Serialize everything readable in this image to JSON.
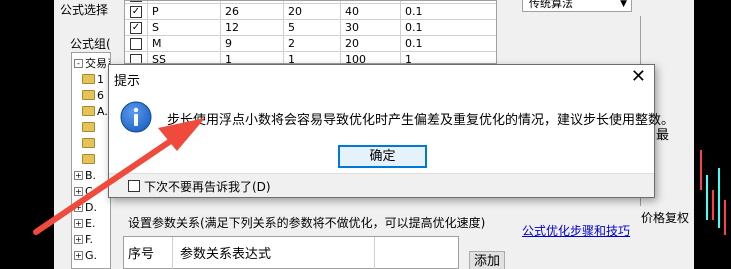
{
  "background": {
    "formula_select_label": "公式选择",
    "formula_group_label": "公式组(",
    "tree_items": [
      {
        "box": "-",
        "label": "交易系",
        "folder": false
      },
      {
        "box": "",
        "label": "1",
        "folder": true
      },
      {
        "box": "",
        "label": "6",
        "folder": true
      },
      {
        "box": "",
        "label": "A.",
        "folder": true
      },
      {
        "box": "",
        "label": "",
        "folder": true
      },
      {
        "box": "",
        "label": "",
        "folder": true
      },
      {
        "box": "",
        "label": "",
        "folder": true
      },
      {
        "box": "+",
        "label": "B.",
        "folder": false
      },
      {
        "box": "+",
        "label": "C.",
        "folder": false
      },
      {
        "box": "+",
        "label": "D.",
        "folder": false
      },
      {
        "box": "+",
        "label": "E.",
        "folder": false
      },
      {
        "box": "+",
        "label": "F.",
        "folder": false
      },
      {
        "box": "+",
        "label": "G.",
        "folder": false
      }
    ],
    "param_rows": [
      {
        "checked": "",
        "name": "",
        "c1": "",
        "c2": "",
        "c3": "",
        "c4": ""
      },
      {
        "checked": "✓",
        "name": "P",
        "c1": "26",
        "c2": "20",
        "c3": "40",
        "c4": "0.1"
      },
      {
        "checked": "✓",
        "name": "S",
        "c1": "12",
        "c2": "5",
        "c3": "30",
        "c4": "0.1"
      },
      {
        "checked": "",
        "name": "M",
        "c1": "9",
        "c2": "2",
        "c3": "20",
        "c4": "0.1"
      },
      {
        "checked": "",
        "name": "SS",
        "c1": "1",
        "c2": "1",
        "c3": "100",
        "c4": "1"
      }
    ],
    "algorithm_value": "传统算法",
    "right_partial_text": "最",
    "price_adjust_label": "价格复权",
    "relation_label": "设置参数关系(满足下列关系的参数将不做优化，可以提高优化速度)",
    "tips_link": "公式优化步骤和技巧",
    "relation_table_headers": [
      "序号",
      "参数关系表达式"
    ],
    "add_button": "添加"
  },
  "msgbox": {
    "title": "提示",
    "close_glyph": "✕",
    "icon": "info-icon",
    "message": "步长使用浮点小数将会容易导致优化时产生偏差及重复优化的情况，建议步长使用整数。",
    "ok_label": "确定",
    "dont_show_label": "下次不要再告诉我了(D)"
  },
  "colors": {
    "arrow": "#f04a3c",
    "info_icon": "#1d63c4",
    "link": "#0000cc",
    "ok_border": "#0078d7"
  }
}
